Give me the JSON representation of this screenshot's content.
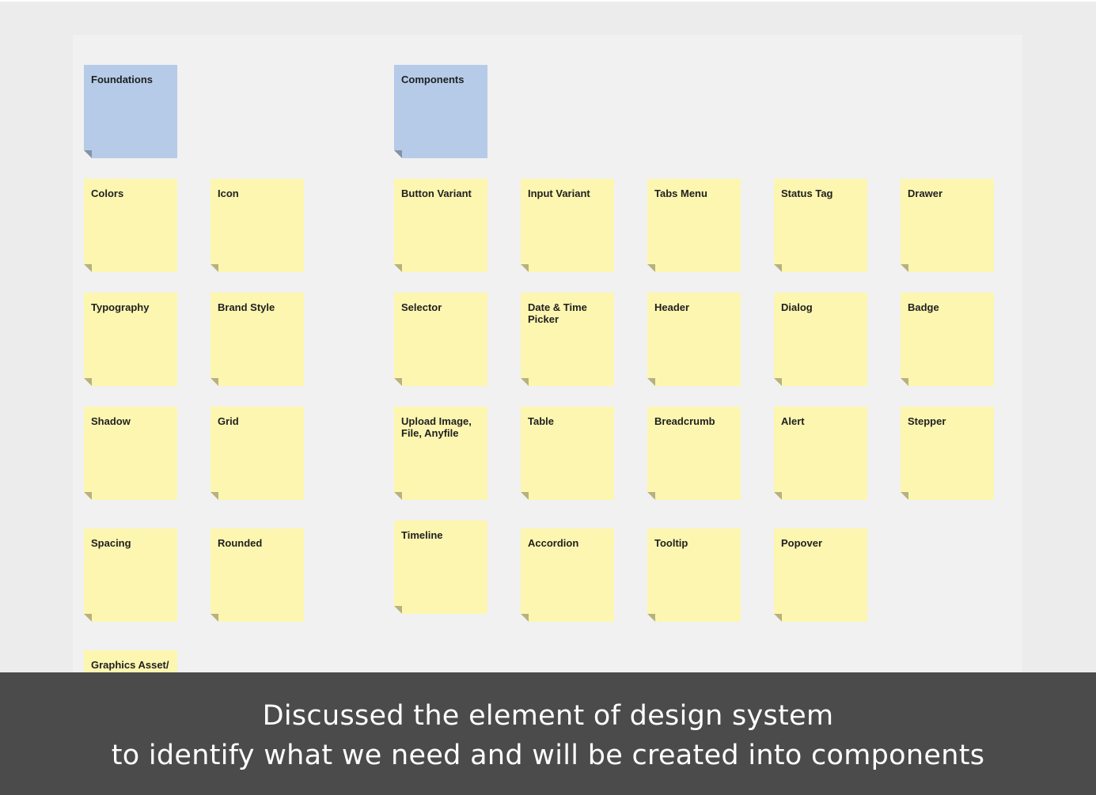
{
  "board": {
    "foundations_header": "Foundations",
    "components_header": "Components",
    "foundations": [
      "Colors",
      "Icon",
      "Typography",
      "Brand Style",
      "Shadow",
      "Grid",
      "Spacing",
      "Rounded",
      "Graphics Asset/ Stroke"
    ],
    "components": [
      "Button Variant",
      "Input Variant",
      "Tabs Menu",
      "Status Tag",
      "Drawer",
      "Selector",
      "Date & Time Picker",
      "Header",
      "Dialog",
      "Badge",
      "Upload Image, File, Anyfile",
      "Table",
      "Breadcrumb",
      "Alert",
      "Stepper",
      "Timeline",
      "Accordion",
      "Tooltip",
      "Popover"
    ]
  },
  "caption": {
    "line1": "Discussed the element of design system",
    "line2": "to identify what we need and will be created into components"
  },
  "colors": {
    "sticky_yellow": "#fdf6b0",
    "sticky_blue": "#b6cbe8",
    "caption_bg": "#4b4b4b"
  }
}
